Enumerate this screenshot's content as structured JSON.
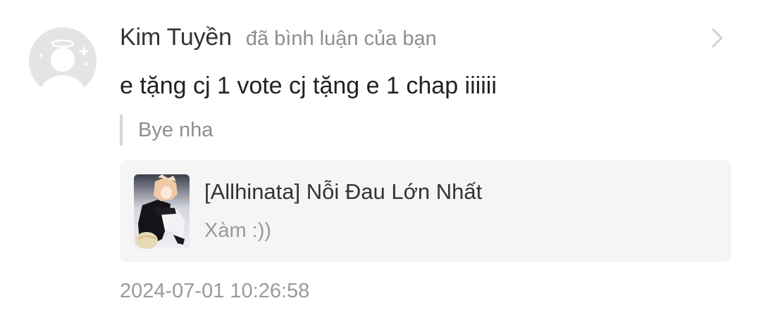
{
  "notification": {
    "user": {
      "name": "Kim Tuyền",
      "avatar_icon": "default-angel-avatar-icon"
    },
    "action_text": "đã bình luận của bạn",
    "comment_text": "e tặng cj 1 vote cj tặng e 1 chap iiiiii",
    "quoted_text": "Bye nha",
    "story": {
      "title": "[Allhinata] Nỗi Đau Lớn Nhất",
      "subtitle": "Xàm :))",
      "cover_icon": "story-cover-image"
    },
    "timestamp": "2024-07-01 10:26:58",
    "open_icon": "chevron-right-icon"
  },
  "colors": {
    "username": "#333333",
    "secondary_text": "#8e8e8e",
    "card_background": "#f5f5f6",
    "quote_bar": "#d6d6d6",
    "avatar_background": "#e4e4e4"
  }
}
